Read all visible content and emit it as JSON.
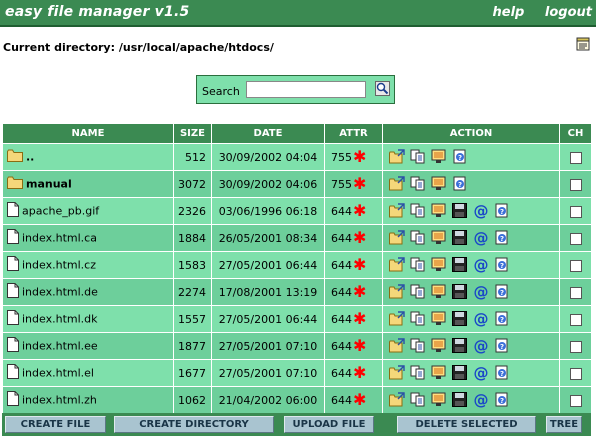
{
  "app": {
    "title": "easy file manager v1.5",
    "help_label": "help",
    "logout_label": "logout"
  },
  "current_directory": {
    "label": "Current directory:",
    "path": "/usr/local/apache/htdocs/"
  },
  "search": {
    "label": "Search",
    "value": ""
  },
  "table": {
    "headers": {
      "name": "NAME",
      "size": "SIZE",
      "date": "DATE",
      "attr": "ATTR",
      "action": "ACTION",
      "ch": "CH"
    },
    "rows": [
      {
        "name": "..",
        "type": "folder",
        "size": "512",
        "date": "30/09/2002 04:04",
        "attr": "755"
      },
      {
        "name": "manual",
        "type": "folder",
        "size": "3072",
        "date": "30/09/2002 04:06",
        "attr": "755"
      },
      {
        "name": "apache_pb.gif",
        "type": "file",
        "size": "2326",
        "date": "03/06/1996 06:18",
        "attr": "644"
      },
      {
        "name": "index.html.ca",
        "type": "file",
        "size": "1884",
        "date": "26/05/2001 08:34",
        "attr": "644"
      },
      {
        "name": "index.html.cz",
        "type": "file",
        "size": "1583",
        "date": "27/05/2001 06:44",
        "attr": "644"
      },
      {
        "name": "index.html.de",
        "type": "file",
        "size": "2274",
        "date": "17/08/2001 13:19",
        "attr": "644"
      },
      {
        "name": "index.html.dk",
        "type": "file",
        "size": "1557",
        "date": "27/05/2001 06:44",
        "attr": "644"
      },
      {
        "name": "index.html.ee",
        "type": "file",
        "size": "1877",
        "date": "27/05/2001 07:10",
        "attr": "644"
      },
      {
        "name": "index.html.el",
        "type": "file",
        "size": "1677",
        "date": "27/05/2001 07:10",
        "attr": "644"
      },
      {
        "name": "index.html.zh",
        "type": "file",
        "size": "1062",
        "date": "21/04/2002 06:00",
        "attr": "644"
      }
    ],
    "folder_actions": [
      "rename-icon",
      "copy-icon",
      "move-icon",
      "info-icon"
    ],
    "file_actions": [
      "rename-icon",
      "copy-icon",
      "move-icon",
      "save-icon",
      "email-icon",
      "info-icon"
    ]
  },
  "buttons": {
    "create_file": "CREATE FILE",
    "create_directory": "CREATE DIRECTORY",
    "upload_file": "UPLOAD FILE",
    "delete_selected": "DELETE SELECTED",
    "tree": "TREE"
  },
  "colors": {
    "header_green": "#3b8a52",
    "row_light": "#7ee0ab",
    "row_dark": "#6dcf9b",
    "button": "#a9c4d0",
    "star": "#ff0000"
  }
}
